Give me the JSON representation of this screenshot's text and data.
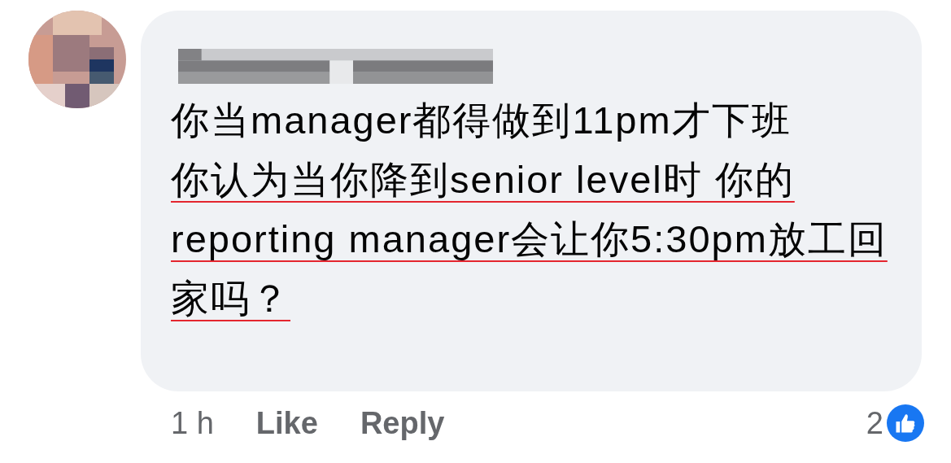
{
  "comment": {
    "paragraphs": [
      {
        "text": "你当manager都得做到11pm才下班",
        "underlined": false
      },
      {
        "text": "你认为当你降到senior level时 你的reporting manager会让你5:30pm放工回家吗？",
        "underlined": true
      }
    ],
    "time": "1 h",
    "actions": [
      "Like",
      "Reply"
    ],
    "reaction_count": "2"
  }
}
